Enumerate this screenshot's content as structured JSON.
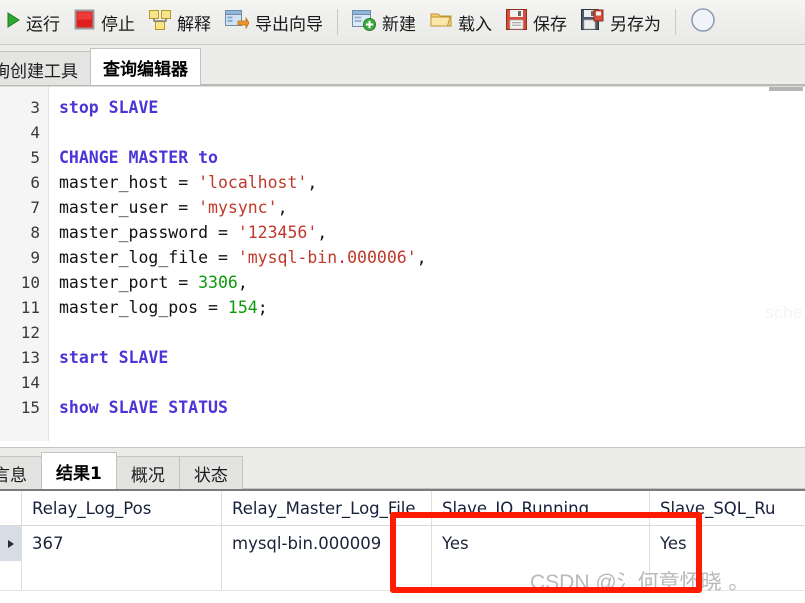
{
  "toolbar": {
    "items": [
      {
        "label": "运行",
        "icon": "play-icon"
      },
      {
        "label": "停止",
        "icon": "stop-icon"
      },
      {
        "label": "解释",
        "icon": "explain-icon"
      },
      {
        "label": "导出向导",
        "icon": "export-wizard-icon"
      },
      {
        "label": "新建",
        "icon": "new-query-icon"
      },
      {
        "label": "载入",
        "icon": "open-folder-icon"
      },
      {
        "label": "保存",
        "icon": "save-floppy-icon"
      },
      {
        "label": "另存为",
        "icon": "save-as-floppy-icon"
      }
    ],
    "trailing_icon": "circle-icon"
  },
  "editor_tabs": {
    "items": [
      {
        "label": "询创建工具",
        "active": false
      },
      {
        "label": "查询编辑器",
        "active": true
      }
    ]
  },
  "editor": {
    "ghost_text": "sche",
    "lines": [
      {
        "num": "3",
        "tokens": [
          {
            "t": "stop SLAVE",
            "c": "kw"
          }
        ]
      },
      {
        "num": "4",
        "tokens": []
      },
      {
        "num": "5",
        "tokens": [
          {
            "t": "CHANGE MASTER to",
            "c": "kw"
          }
        ]
      },
      {
        "num": "6",
        "tokens": [
          {
            "t": "master_host = ",
            "c": "pln"
          },
          {
            "t": "'localhost'",
            "c": "str"
          },
          {
            "t": ",",
            "c": "pln"
          }
        ]
      },
      {
        "num": "7",
        "tokens": [
          {
            "t": "master_user = ",
            "c": "pln"
          },
          {
            "t": "'mysync'",
            "c": "str"
          },
          {
            "t": ",",
            "c": "pln"
          }
        ]
      },
      {
        "num": "8",
        "tokens": [
          {
            "t": "master_password = ",
            "c": "pln"
          },
          {
            "t": "'123456'",
            "c": "str"
          },
          {
            "t": ",",
            "c": "pln"
          }
        ]
      },
      {
        "num": "9",
        "tokens": [
          {
            "t": "master_log_file = ",
            "c": "pln"
          },
          {
            "t": "'mysql-bin.000006'",
            "c": "str"
          },
          {
            "t": ",",
            "c": "pln"
          }
        ]
      },
      {
        "num": "10",
        "tokens": [
          {
            "t": "master_port = ",
            "c": "pln"
          },
          {
            "t": "3306",
            "c": "num"
          },
          {
            "t": ",",
            "c": "pln"
          }
        ]
      },
      {
        "num": "11",
        "tokens": [
          {
            "t": "master_log_pos = ",
            "c": "pln"
          },
          {
            "t": "154",
            "c": "num"
          },
          {
            "t": ";",
            "c": "pln"
          }
        ]
      },
      {
        "num": "12",
        "tokens": []
      },
      {
        "num": "13",
        "tokens": [
          {
            "t": "start SLAVE",
            "c": "kw"
          }
        ]
      },
      {
        "num": "14",
        "tokens": []
      },
      {
        "num": "15",
        "tokens": [
          {
            "t": "show SLAVE STATUS",
            "c": "kw"
          }
        ]
      }
    ]
  },
  "result_tabs": {
    "items": [
      {
        "label": "言息",
        "active": false
      },
      {
        "label": "结果1",
        "active": true
      },
      {
        "label": "概况",
        "active": false
      },
      {
        "label": "状态",
        "active": false
      }
    ]
  },
  "result_grid": {
    "columns": [
      "Relay_Log_Pos",
      "Relay_Master_Log_File",
      "Slave_IO_Running",
      "Slave_SQL_Ru"
    ],
    "rows": [
      {
        "selected": true,
        "cells": [
          "367",
          "mysql-bin.000009",
          "Yes",
          "Yes"
        ]
      }
    ]
  },
  "annotation": {
    "highlight_color": "#ff1a00"
  },
  "watermark": {
    "prefix": "CSDN @氵",
    "name": "何章怀晓 。"
  }
}
